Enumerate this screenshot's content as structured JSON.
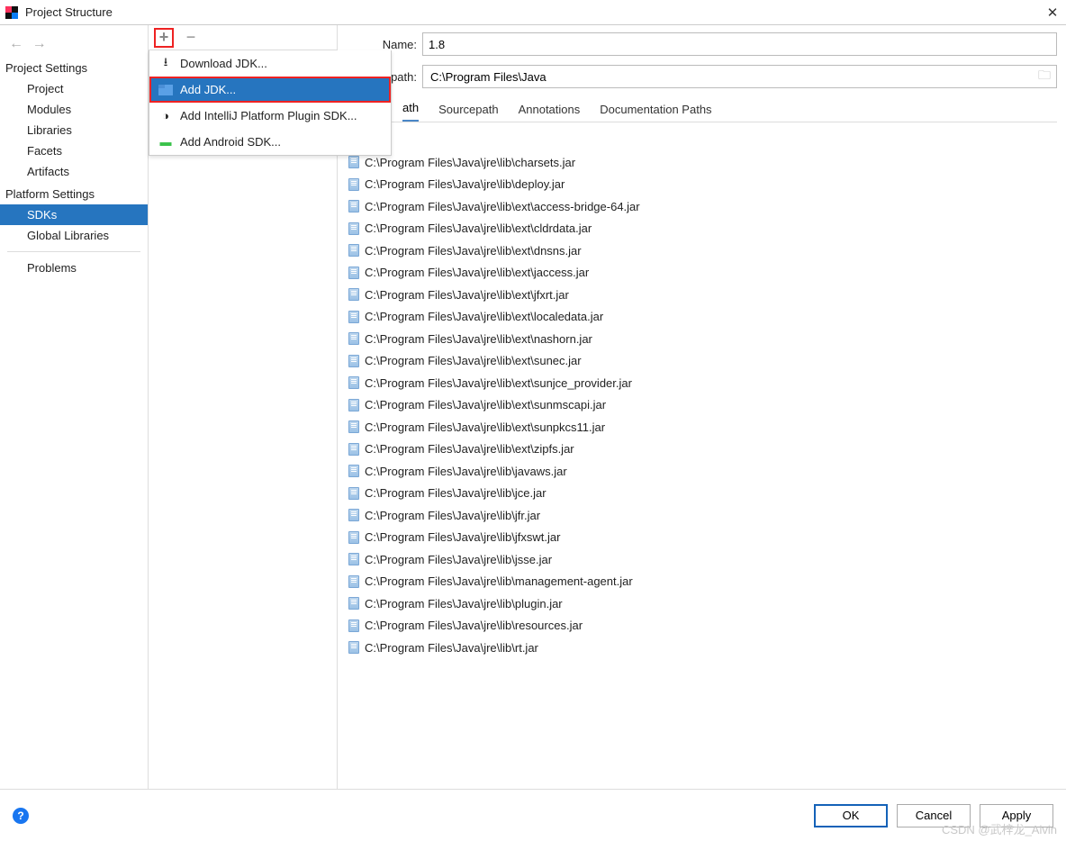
{
  "window": {
    "title": "Project Structure"
  },
  "sidebar": {
    "section1_header": "Project Settings",
    "section1": [
      {
        "label": "Project"
      },
      {
        "label": "Modules"
      },
      {
        "label": "Libraries"
      },
      {
        "label": "Facets"
      },
      {
        "label": "Artifacts"
      }
    ],
    "section2_header": "Platform Settings",
    "section2": [
      {
        "label": "SDKs"
      },
      {
        "label": "Global Libraries"
      }
    ],
    "section3": [
      {
        "label": "Problems"
      }
    ]
  },
  "dropdown": {
    "items": [
      {
        "icon": "download-icon",
        "label": "Download JDK..."
      },
      {
        "icon": "folder-icon",
        "label": "Add JDK..."
      },
      {
        "icon": "intellij-icon",
        "label": "Add IntelliJ Platform Plugin SDK..."
      },
      {
        "icon": "android-icon",
        "label": "Add Android SDK..."
      }
    ]
  },
  "form": {
    "name_label": "Name:",
    "name_value": "1.8",
    "home_path_label_suffix": "e path:",
    "home_path_value": "C:\\Program Files\\Java"
  },
  "tabs": [
    {
      "label": "ath"
    },
    {
      "label": "Sourcepath"
    },
    {
      "label": "Annotations"
    },
    {
      "label": "Documentation Paths"
    }
  ],
  "jars": [
    "C:\\Program Files\\Java\\jre\\lib\\charsets.jar",
    "C:\\Program Files\\Java\\jre\\lib\\deploy.jar",
    "C:\\Program Files\\Java\\jre\\lib\\ext\\access-bridge-64.jar",
    "C:\\Program Files\\Java\\jre\\lib\\ext\\cldrdata.jar",
    "C:\\Program Files\\Java\\jre\\lib\\ext\\dnsns.jar",
    "C:\\Program Files\\Java\\jre\\lib\\ext\\jaccess.jar",
    "C:\\Program Files\\Java\\jre\\lib\\ext\\jfxrt.jar",
    "C:\\Program Files\\Java\\jre\\lib\\ext\\localedata.jar",
    "C:\\Program Files\\Java\\jre\\lib\\ext\\nashorn.jar",
    "C:\\Program Files\\Java\\jre\\lib\\ext\\sunec.jar",
    "C:\\Program Files\\Java\\jre\\lib\\ext\\sunjce_provider.jar",
    "C:\\Program Files\\Java\\jre\\lib\\ext\\sunmscapi.jar",
    "C:\\Program Files\\Java\\jre\\lib\\ext\\sunpkcs11.jar",
    "C:\\Program Files\\Java\\jre\\lib\\ext\\zipfs.jar",
    "C:\\Program Files\\Java\\jre\\lib\\javaws.jar",
    "C:\\Program Files\\Java\\jre\\lib\\jce.jar",
    "C:\\Program Files\\Java\\jre\\lib\\jfr.jar",
    "C:\\Program Files\\Java\\jre\\lib\\jfxswt.jar",
    "C:\\Program Files\\Java\\jre\\lib\\jsse.jar",
    "C:\\Program Files\\Java\\jre\\lib\\management-agent.jar",
    "C:\\Program Files\\Java\\jre\\lib\\plugin.jar",
    "C:\\Program Files\\Java\\jre\\lib\\resources.jar",
    "C:\\Program Files\\Java\\jre\\lib\\rt.jar"
  ],
  "footer": {
    "ok": "OK",
    "cancel": "Cancel",
    "apply": "Apply"
  },
  "watermark": "CSDN @武梓龙_Alvin"
}
